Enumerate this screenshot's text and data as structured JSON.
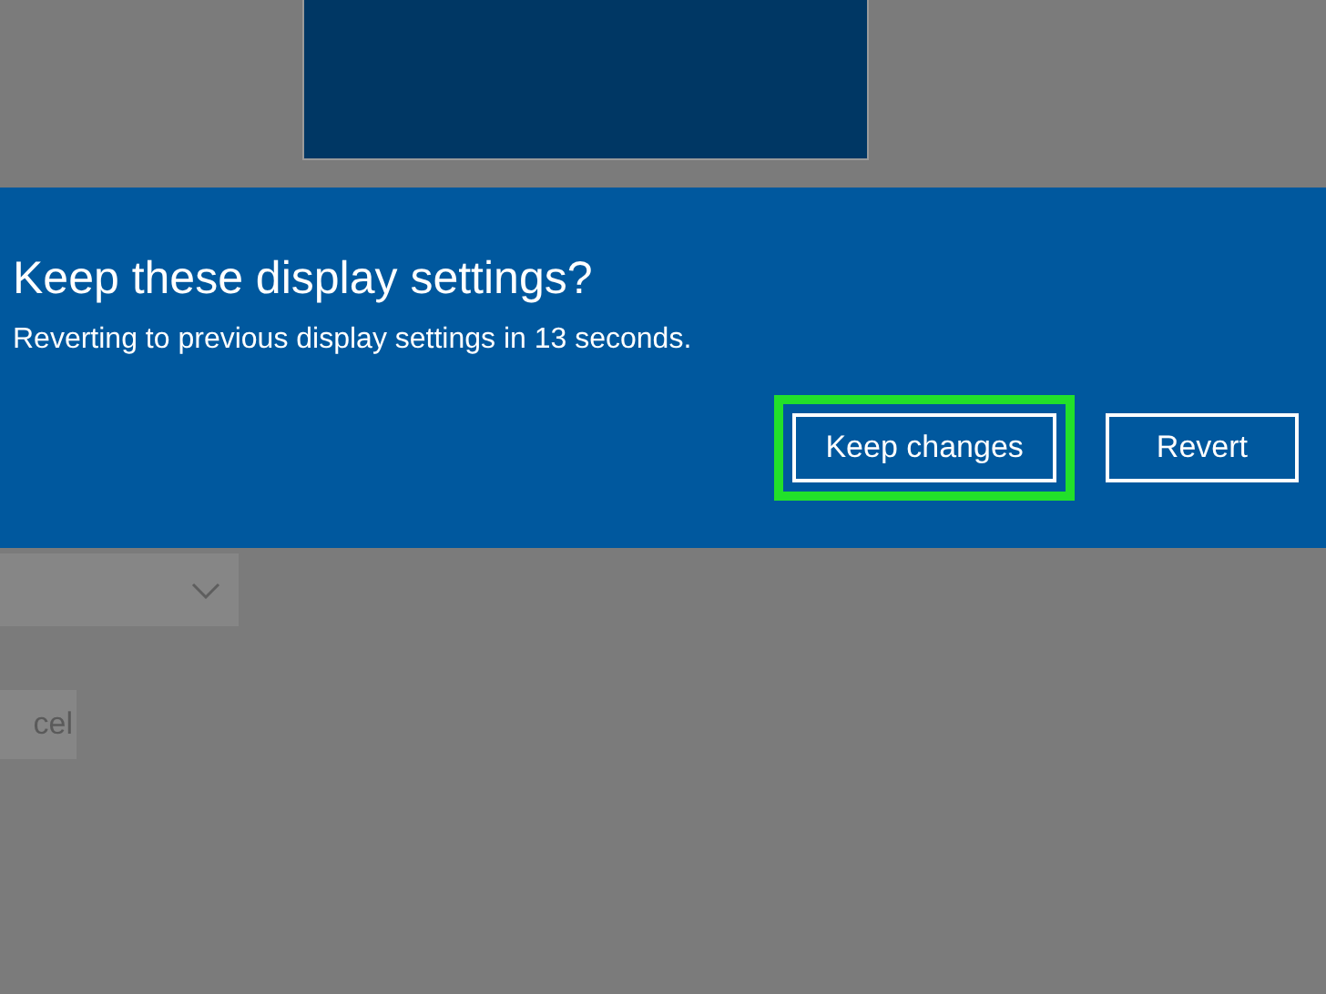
{
  "dialog": {
    "title": "Keep these display settings?",
    "message": "Reverting to previous display settings in 13 seconds.",
    "buttons": [
      {
        "label": "Keep changes",
        "highlighted": true
      },
      {
        "label": "Revert",
        "highlighted": false
      }
    ]
  },
  "background": {
    "button": {
      "label": "cel"
    }
  }
}
